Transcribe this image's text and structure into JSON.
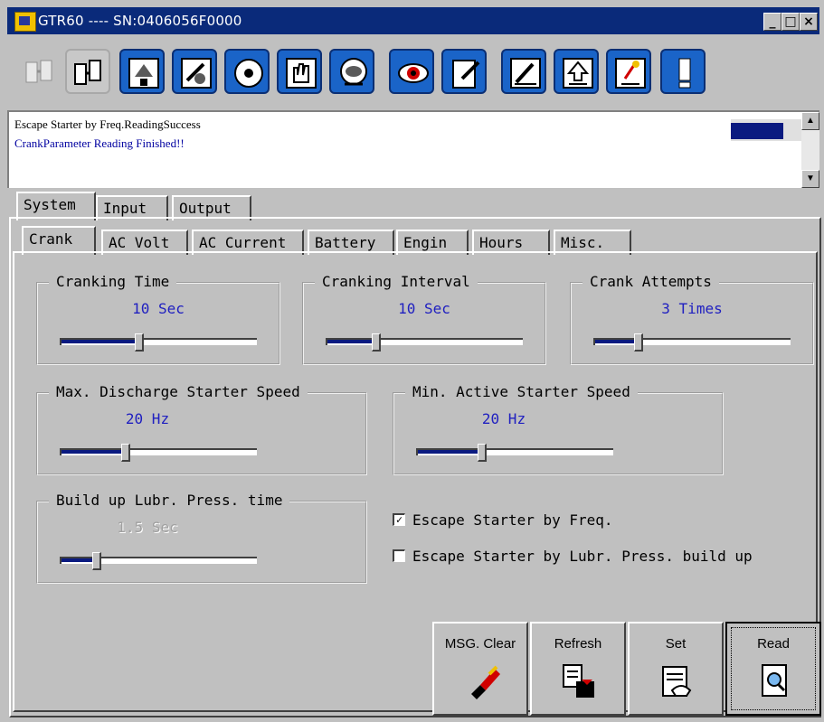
{
  "window": {
    "title": "GTR60 ---- SN:0406056F0000",
    "controls": [
      "_",
      "□",
      "×"
    ]
  },
  "toolbar": {
    "icons": [
      "disconnect-icon",
      "connect-icon",
      "upload-icon",
      "settings-icon",
      "gauge-icon",
      "hand-icon",
      "sensor-icon",
      "eye-icon",
      "edit-doc-icon",
      "pencil-icon",
      "export-icon",
      "import-icon",
      "alert-icon"
    ]
  },
  "messages": {
    "line1": "Escape Starter by Freq.ReadingSuccess",
    "line2": "CrankParameter Reading Finished!!"
  },
  "tabs_top": [
    "System",
    "Input",
    "Output"
  ],
  "tabs_sub": [
    "Crank",
    "AC Volt",
    "AC Current",
    "Battery",
    "Engin",
    "Hours",
    "Misc."
  ],
  "groups": {
    "cranking_time": {
      "title": "Cranking Time",
      "value": "10 Sec",
      "level": 0.4
    },
    "cranking_interval": {
      "title": "Cranking Interval",
      "value": "10 Sec",
      "level": 0.25
    },
    "crank_attempts": {
      "title": "Crank Attempts",
      "value": "3 Times",
      "level": 0.22
    },
    "max_discharge": {
      "title": "Max. Discharge Starter Speed",
      "value": "20 Hz",
      "level": 0.33
    },
    "min_active": {
      "title": "Min. Active Starter Speed",
      "value": "20 Hz",
      "level": 0.33
    },
    "build_up": {
      "title": "Build up Lubr. Press. time",
      "value": "1.5 Sec",
      "level": 0.18
    }
  },
  "checkboxes": {
    "escape_freq": {
      "label": "Escape Starter by Freq.",
      "checked": true
    },
    "escape_lubr": {
      "label": "Escape Starter by Lubr. Press. build up",
      "checked": false
    }
  },
  "buttons": {
    "msg_clear": "MSG. Clear",
    "refresh": "Refresh",
    "set": "Set",
    "read": "Read"
  }
}
